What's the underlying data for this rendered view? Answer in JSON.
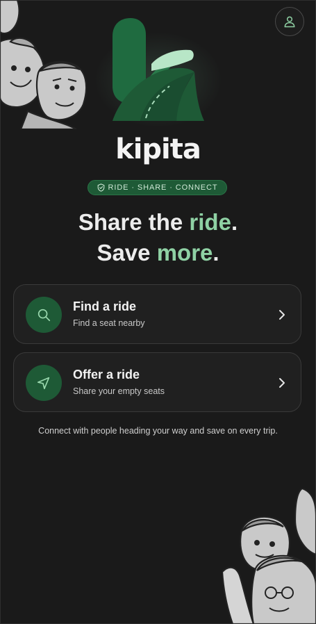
{
  "app": {
    "brand_name": "kipita"
  },
  "header": {
    "profile_icon": "user-icon"
  },
  "tagline": {
    "icon": "shield-check-icon",
    "text": "RIDE · SHARE · CONNECT"
  },
  "headline": {
    "line1_pre": "Share the ",
    "line1_accent": "ride",
    "line1_end": ".",
    "line2_pre": "Save ",
    "line2_accent": "more",
    "line2_end": "."
  },
  "actions": [
    {
      "title": "Find a ride",
      "subtitle": "Find a seat nearby",
      "icon": "search-icon"
    },
    {
      "title": "Offer a ride",
      "subtitle": "Share your empty seats",
      "icon": "navigation-arrow-icon"
    }
  ],
  "footer": {
    "text": "Connect with people heading your way and save on every trip."
  },
  "colors": {
    "background": "#1a1a1a",
    "brand_green": "#1e5a36",
    "accent_green": "#8fd1a4",
    "card": "#202020"
  }
}
